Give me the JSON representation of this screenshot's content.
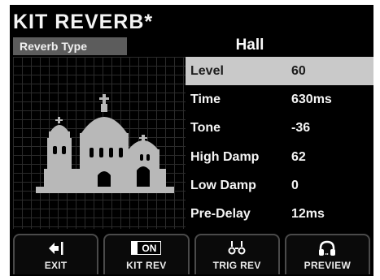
{
  "header": {
    "title": "KIT REVERB*"
  },
  "reverb_type": {
    "label": "Reverb Type",
    "value": "Hall"
  },
  "params": [
    {
      "name": "Level",
      "value": "60",
      "selected": true
    },
    {
      "name": "Time",
      "value": "630ms",
      "selected": false
    },
    {
      "name": "Tone",
      "value": "-36",
      "selected": false
    },
    {
      "name": "High Damp",
      "value": "62",
      "selected": false
    },
    {
      "name": "Low Damp",
      "value": "0",
      "selected": false
    },
    {
      "name": "Pre-Delay",
      "value": "12ms",
      "selected": false
    }
  ],
  "softkeys": [
    {
      "label": "EXIT",
      "icon": "exit-arrow-icon"
    },
    {
      "label": "KIT REV",
      "icon": "on-toggle-icon",
      "toggle_text": "ON"
    },
    {
      "label": "TRIG REV",
      "icon": "trigger-icon"
    },
    {
      "label": "PREVIEW",
      "icon": "headphones-icon"
    }
  ],
  "colors": {
    "background": "#000000",
    "selected_row": "#c9c9c9",
    "type_label_bg": "#5c5c5c",
    "illustration": "#b8b8b8"
  }
}
